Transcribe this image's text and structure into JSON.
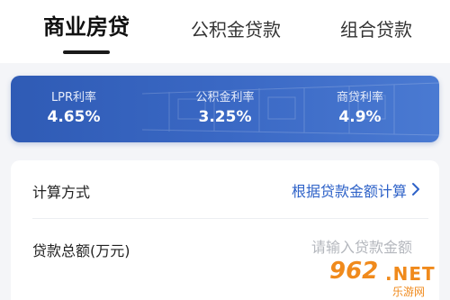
{
  "tabs": [
    {
      "label": "商业房贷",
      "active": true
    },
    {
      "label": "公积金贷款",
      "active": false
    },
    {
      "label": "组合贷款",
      "active": false
    }
  ],
  "rates": [
    {
      "label": "LPR利率",
      "value": "4.65%"
    },
    {
      "label": "公积金利率",
      "value": "3.25%"
    },
    {
      "label": "商贷利率",
      "value": "4.9%"
    }
  ],
  "form": {
    "calc_method_label": "计算方式",
    "calc_method_value": "根据贷款金额计算",
    "loan_amount_label": "贷款总额(万元)",
    "loan_amount_placeholder": "请输入贷款金额",
    "loan_amount_value": ""
  },
  "watermark": {
    "number": "962",
    "domain": ".NET",
    "site": "乐游网"
  },
  "colors": {
    "accent_blue": "#2e62c8",
    "card_gradient_start": "#2f5bb5",
    "card_gradient_end": "#4a7ad2",
    "watermark_orange": "#f08a1c"
  }
}
